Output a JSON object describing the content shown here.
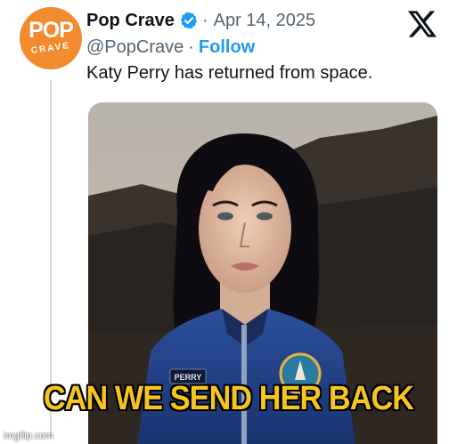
{
  "tweet": {
    "avatar": {
      "line1": "POP",
      "line2": "CRAVE",
      "color": "#f28a2e"
    },
    "display_name": "Pop Crave",
    "verified_icon": "verified-badge-icon",
    "separator": "·",
    "date": "Apr 14, 2025",
    "handle": "@PopCrave",
    "handle_separator": "·",
    "follow_label": "Follow",
    "platform_icon": "x-logo-icon",
    "text": "Katy Perry has returned from space.",
    "media": {
      "name_patch": "PERRY",
      "description_icon": "photo-image"
    }
  },
  "meme": {
    "caption": "CAN WE SEND HER BACK",
    "watermark": "imgflip.com"
  },
  "colors": {
    "link_blue": "#1d9bf0",
    "text_gray": "#536471",
    "caption_yellow": "#f6c51e"
  }
}
